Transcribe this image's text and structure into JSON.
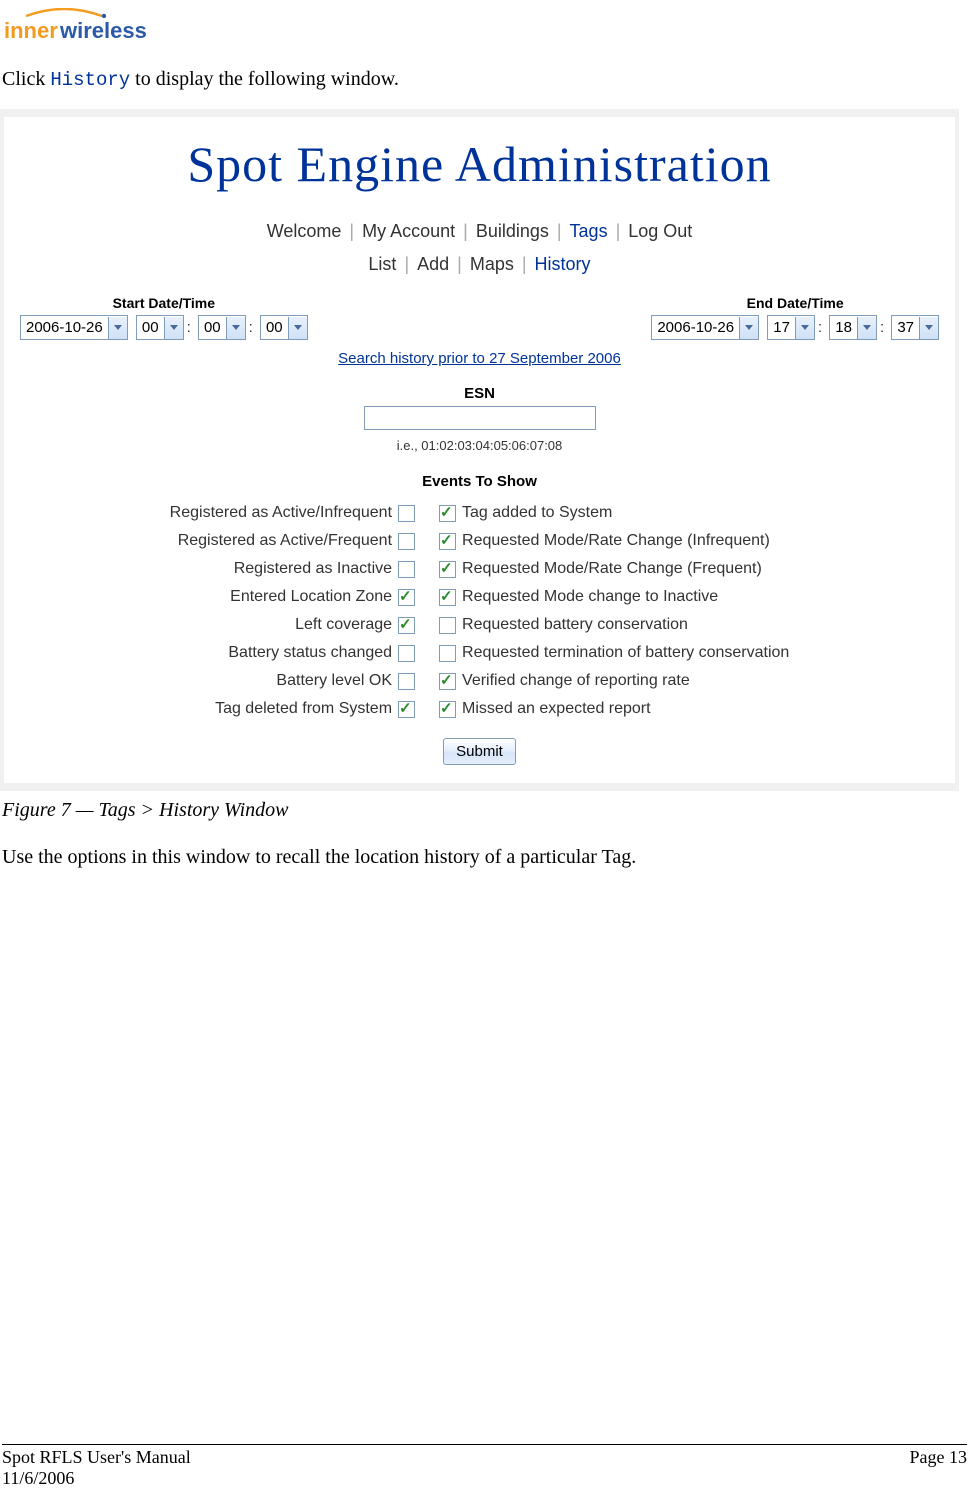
{
  "logo": {
    "prefix_color": "#f39b1e",
    "name_color": "#2a5aa8"
  },
  "intro": {
    "prefix": "Click ",
    "code": "History",
    "suffix": " to display the following window."
  },
  "screenshot": {
    "title": "Spot Engine Administration",
    "main_nav": [
      "Welcome",
      "My Account",
      "Buildings",
      "Tags",
      "Log Out"
    ],
    "main_nav_active_index": 3,
    "sub_nav": [
      "List",
      "Add",
      "Maps",
      "History"
    ],
    "sub_nav_active_index": 3,
    "start": {
      "label": "Start Date/Time",
      "date": "2006-10-26",
      "h": "00",
      "m": "00",
      "s": "00"
    },
    "end": {
      "label": "End Date/Time",
      "date": "2006-10-26",
      "h": "17",
      "m": "18",
      "s": "37"
    },
    "search_prior": "Search history prior to 27 September 2006",
    "esn": {
      "label": "ESN",
      "hint": "i.e., 01:02:03:04:05:06:07:08"
    },
    "events_label": "Events To Show",
    "events_left": [
      {
        "label": "Registered as Active/Infrequent",
        "checked": false
      },
      {
        "label": "Registered as Active/Frequent",
        "checked": false
      },
      {
        "label": "Registered as Inactive",
        "checked": false
      },
      {
        "label": "Entered Location Zone",
        "checked": true
      },
      {
        "label": "Left coverage",
        "checked": true
      },
      {
        "label": "Battery status changed",
        "checked": false
      },
      {
        "label": "Battery level OK",
        "checked": false
      },
      {
        "label": "Tag deleted from System",
        "checked": true
      }
    ],
    "events_right": [
      {
        "label": "Tag added to System",
        "checked": true
      },
      {
        "label": "Requested Mode/Rate Change (Infrequent)",
        "checked": true
      },
      {
        "label": "Requested Mode/Rate Change (Frequent)",
        "checked": true
      },
      {
        "label": "Requested Mode change to Inactive",
        "checked": true
      },
      {
        "label": "Requested battery conservation",
        "checked": false
      },
      {
        "label": "Requested termination of battery conservation",
        "checked": false
      },
      {
        "label": "Verified change of reporting rate",
        "checked": true
      },
      {
        "label": "Missed an expected report",
        "checked": true
      }
    ],
    "submit_label": "Submit"
  },
  "caption": "Figure 7 — Tags > History Window",
  "body_text": "Use the options in this window to recall the location history of a particular Tag.",
  "footer": {
    "left1": "Spot RFLS User's Manual",
    "left2": "11/6/2006",
    "right": "Page 13"
  }
}
